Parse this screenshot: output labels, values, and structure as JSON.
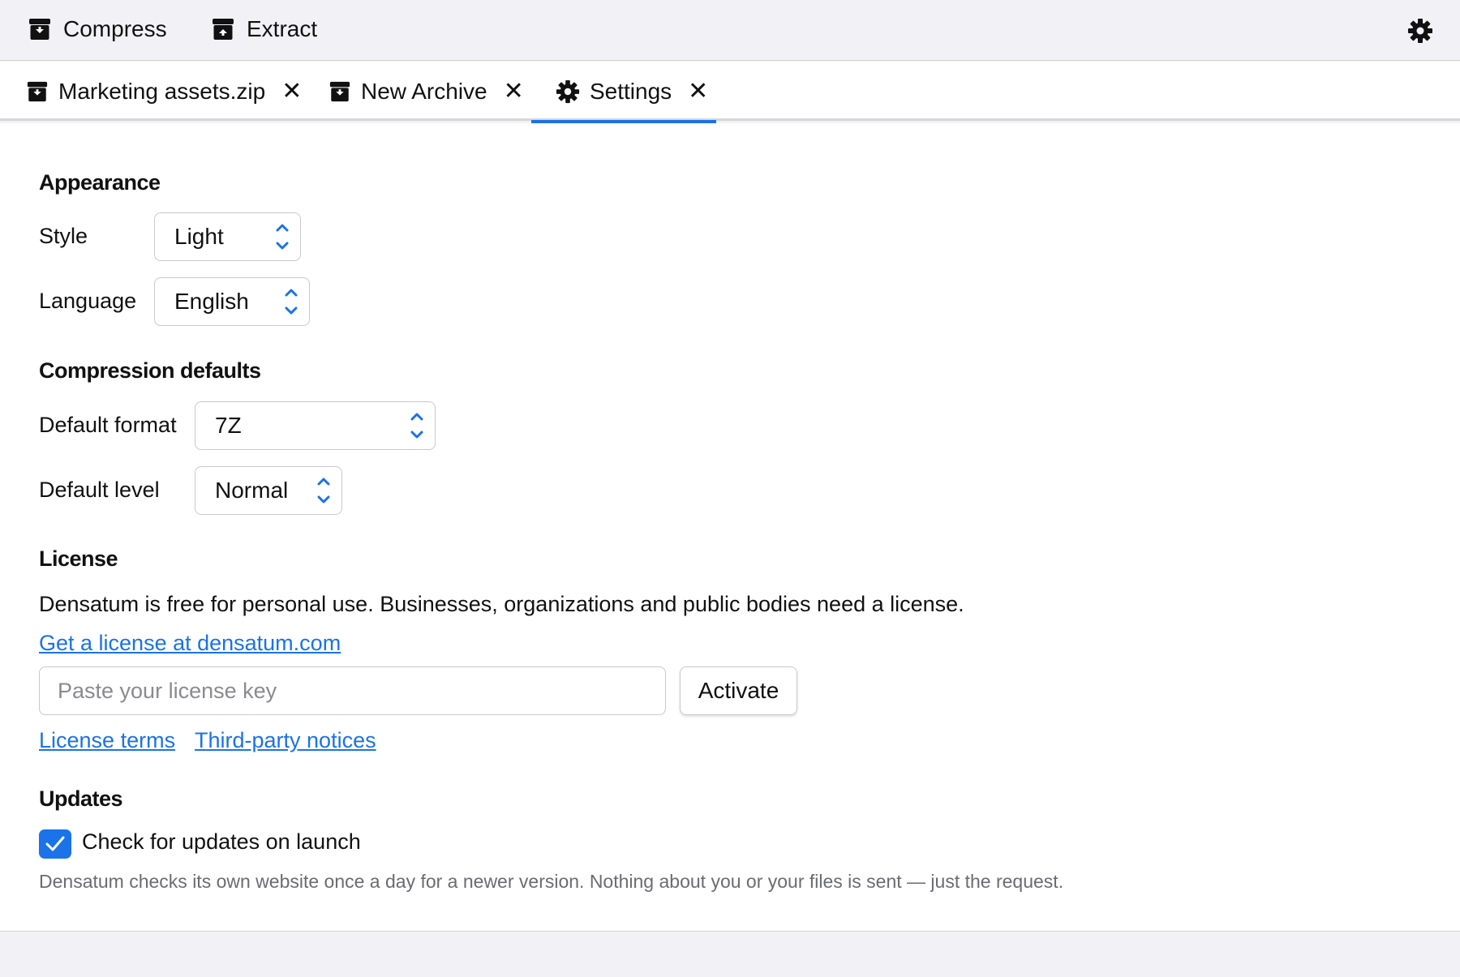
{
  "toolbar": {
    "compress_label": "Compress",
    "extract_label": "Extract"
  },
  "tabs": [
    {
      "label": "Marketing assets.zip",
      "icon": "archive-icon",
      "active": false
    },
    {
      "label": "New Archive",
      "icon": "archive-icon",
      "active": false
    },
    {
      "label": "Settings",
      "icon": "gear-icon",
      "active": true
    }
  ],
  "sections": {
    "appearance": {
      "heading": "Appearance",
      "style_label": "Style",
      "style_value": "Light",
      "language_label": "Language",
      "language_value": "English"
    },
    "compression": {
      "heading": "Compression defaults",
      "format_label": "Default format",
      "format_value": "7Z",
      "level_label": "Default level",
      "level_value": "Normal"
    },
    "license": {
      "heading": "License",
      "description": "Densatum is free for personal use. Businesses, organizations and public bodies need a license.",
      "get_link": "Get a license at densatum.com",
      "key_placeholder": "Paste your license key",
      "key_value": "",
      "activate_label": "Activate",
      "terms_link": "License terms",
      "notices_link": "Third-party notices"
    },
    "updates": {
      "heading": "Updates",
      "check_label": "Check for updates on launch",
      "checked": true,
      "note": "Densatum checks its own website once a day for a newer version. Nothing about you or your files is sent — just the request."
    }
  },
  "colors": {
    "accent": "#1a73e8",
    "chrome_bg": "#f2f2f6",
    "muted_text": "#6b6b72"
  }
}
